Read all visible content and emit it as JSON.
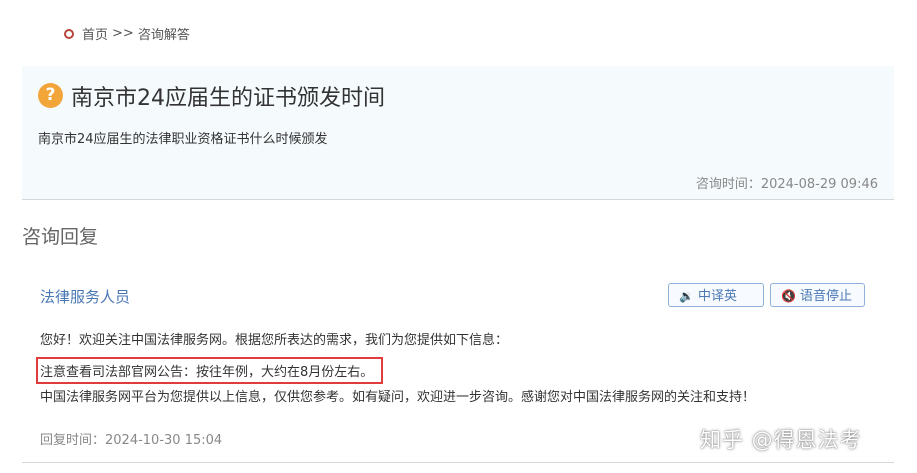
{
  "breadcrumb": {
    "home": "首页",
    "separator": ">>",
    "current": "咨询解答"
  },
  "question": {
    "icon": "?",
    "title": "南京市24应届生的证书颁发时间",
    "body": "南京市24应届生的法律职业资格证书什么时候颁发",
    "time_label": "咨询时间：",
    "time": "2024-08-29 09:46"
  },
  "reply": {
    "heading": "咨询回复",
    "replier": "法律服务人员",
    "translate_label": "中译英",
    "stop_label": "语音停止",
    "lines": [
      "您好！欢迎关注中国法律服务网。根据您所表达的需求，我们为您提供如下信息：",
      "注意查看司法部官网公告：按往年例，大约在8月份左右。",
      "中国法律服务网平台为您提供以上信息，仅供您参考。如有疑问，欢迎进一步咨询。感谢您对中国法律服务网的关注和支持！"
    ],
    "time_label": "回复时间：",
    "time": "2024-10-30 15:04"
  },
  "watermark": "知乎 @得恩法考",
  "colors": {
    "accent": "#4a78b5",
    "highlight_border": "#e03c3c",
    "question_icon": "#f2a63a"
  }
}
